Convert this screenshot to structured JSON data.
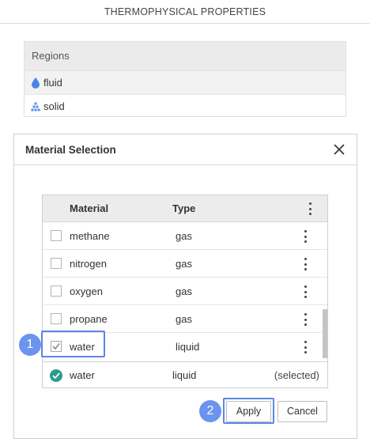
{
  "page": {
    "title": "THERMOPHYSICAL PROPERTIES"
  },
  "regions": {
    "header": "Regions",
    "items": [
      {
        "label": "fluid",
        "icon": "droplet-icon",
        "selected": true
      },
      {
        "label": "solid",
        "icon": "solid-blocks-icon",
        "selected": false
      }
    ]
  },
  "dialog": {
    "title": "Material Selection",
    "grid": {
      "columns": {
        "material": "Material",
        "type": "Type"
      },
      "rows": [
        {
          "material": "methane",
          "type": "gas",
          "checked": false
        },
        {
          "material": "nitrogen",
          "type": "gas",
          "checked": false
        },
        {
          "material": "oxygen",
          "type": "gas",
          "checked": false
        },
        {
          "material": "propane",
          "type": "gas",
          "checked": false
        },
        {
          "material": "water",
          "type": "liquid",
          "checked": true
        }
      ],
      "selection": {
        "material": "water",
        "type": "liquid",
        "status": "(selected)"
      }
    },
    "buttons": {
      "apply": "Apply",
      "cancel": "Cancel"
    }
  },
  "annotations": {
    "step1": "1",
    "step2": "2"
  },
  "colors": {
    "accent": "#5b87e6",
    "badge": "#6a94ee",
    "teal": "#2a9d8f",
    "droplet": "#4a84e8"
  }
}
